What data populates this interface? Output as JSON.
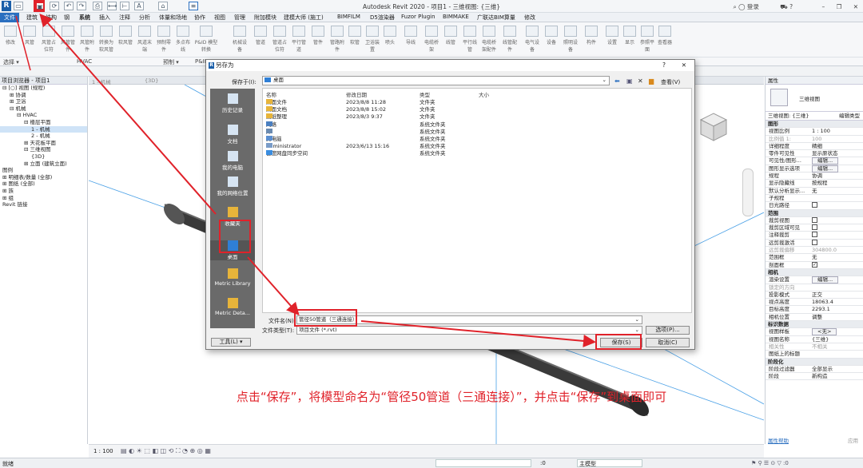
{
  "app": {
    "logo": "R",
    "title": "Autodesk Revit 2020 - 项目1 - 三维视图: {三维}",
    "login": "登录"
  },
  "menu": [
    "文件",
    "建筑",
    "结构",
    "钢",
    "系统",
    "插入",
    "注释",
    "分析",
    "体量和场地",
    "协作",
    "视图",
    "管理",
    "附加模块",
    "建模大师 (施工)",
    "BIMFILM",
    "D5渲染器",
    "Fuzor Plugin",
    "BIMMAKE",
    "广联达BIM算量",
    "修改"
  ],
  "ribbon": {
    "buttons": [
      "修改",
      "风管",
      "风管占位符",
      "风管管件",
      "风管附件",
      "转换为软风管",
      "软风管",
      "风道末端",
      "预制零件",
      "多点布线",
      "P&ID 模型转换",
      "机械设备",
      "管道",
      "管道占位符",
      "平行管道",
      "管件",
      "管路附件",
      "软管",
      "卫浴装置",
      "喷头",
      "导线",
      "电缆桥架",
      "线管",
      "平行线管",
      "电缆桥架配件",
      "线管配件",
      "电气设备",
      "设备",
      "照明设备",
      "构件",
      "设置",
      "显示",
      "参照平面",
      "查看器"
    ],
    "groups": [
      "选择 ▾",
      "HVAC",
      "预制 ▾",
      "P&ID"
    ]
  },
  "browser": {
    "title": "项目浏览器 - 项目1",
    "tree": [
      {
        "t": "⊟ [○] 视图 (规程)",
        "d": 0
      },
      {
        "t": "⊞ 协调",
        "d": 1
      },
      {
        "t": "⊞ 卫浴",
        "d": 1
      },
      {
        "t": "⊟ 机械",
        "d": 1
      },
      {
        "t": "⊟ HVAC",
        "d": 2
      },
      {
        "t": "⊟ 楼层平面",
        "d": 3
      },
      {
        "t": "1 - 机械",
        "d": 4,
        "sel": true
      },
      {
        "t": "2 - 机械",
        "d": 4
      },
      {
        "t": "⊞ 天花板平面",
        "d": 3
      },
      {
        "t": "⊟ 三维视图",
        "d": 3
      },
      {
        "t": "{3D}",
        "d": 4
      },
      {
        "t": "⊞ 立面 (建筑立面)",
        "d": 3
      },
      {
        "t": "图例",
        "d": 0
      },
      {
        "t": "⊞ 明细表/数量 (全部)",
        "d": 0
      },
      {
        "t": "⊞ 图纸 (全部)",
        "d": 0
      },
      {
        "t": "⊞ 族",
        "d": 0
      },
      {
        "t": "⊞ 组",
        "d": 0
      },
      {
        "t": "Revit 链接",
        "d": 0
      }
    ]
  },
  "view": {
    "tabs": [
      "1 - 机械",
      "{3D}"
    ],
    "scale": "1 : 100"
  },
  "properties": {
    "title": "属性",
    "type_name": "三维视图",
    "selector": "三维视图: {三维}",
    "edit_type": "编辑类型",
    "rows": [
      {
        "k": "图形",
        "sec": true
      },
      {
        "k": "视图比例",
        "v": "1 : 100"
      },
      {
        "k": "比例值 1:",
        "v": "100",
        "dim": true
      },
      {
        "k": "详细程度",
        "v": "精细"
      },
      {
        "k": "零件可见性",
        "v": "显示原状态"
      },
      {
        "k": "可见性/图形...",
        "btn": "编辑..."
      },
      {
        "k": "图形显示选项",
        "btn": "编辑..."
      },
      {
        "k": "规程",
        "v": "协调"
      },
      {
        "k": "显示隐藏线",
        "v": "按规程"
      },
      {
        "k": "默认分析显示...",
        "v": "无"
      },
      {
        "k": "子规程",
        "v": ""
      },
      {
        "k": "日光路径",
        "cb": true
      },
      {
        "k": "范围",
        "sec": true
      },
      {
        "k": "裁剪视图",
        "cb": true
      },
      {
        "k": "裁剪区域可见",
        "cb": true
      },
      {
        "k": "注释裁剪",
        "cb": true
      },
      {
        "k": "远剪裁激活",
        "cb": true
      },
      {
        "k": "远剪裁偏移",
        "v": "304800.0",
        "dim": true
      },
      {
        "k": "范围框",
        "v": "无"
      },
      {
        "k": "剖面框",
        "cb": true,
        "checked": true
      },
      {
        "k": "相机",
        "sec": true
      },
      {
        "k": "渲染设置",
        "btn": "编辑..."
      },
      {
        "k": "锁定的方向",
        "v": "",
        "dim": true
      },
      {
        "k": "投影模式",
        "v": "正交"
      },
      {
        "k": "视点高度",
        "v": "18063.4"
      },
      {
        "k": "目标高度",
        "v": "2293.1"
      },
      {
        "k": "相机位置",
        "v": "调整"
      },
      {
        "k": "标识数据",
        "sec": true
      },
      {
        "k": "视图样板",
        "btn": "<无>"
      },
      {
        "k": "视图名称",
        "v": "{三维}"
      },
      {
        "k": "相关性",
        "v": "不相关",
        "dim": true
      },
      {
        "k": "图纸上的标题",
        "v": ""
      },
      {
        "k": "阶段化",
        "sec": true
      },
      {
        "k": "阶段过滤器",
        "v": "全部显示"
      },
      {
        "k": "阶段",
        "v": "新构造"
      }
    ],
    "help": "属性帮助",
    "apply": "应用"
  },
  "dialog": {
    "logo": "R",
    "title": "另存为",
    "help": "?",
    "close": "✕",
    "lookin_label": "保存于(I):",
    "lookin_value": "桌面",
    "view_menu": "查看(V)",
    "places": [
      "历史记录",
      "文档",
      "我的电脑",
      "我的网络位置",
      "收藏夹",
      "桌面",
      "Metric Library",
      "Metric Deta..."
    ],
    "columns": [
      "名称",
      "修改日期",
      "类型",
      "大小"
    ],
    "files": [
      {
        "name": "桌面文件",
        "date": "2023/8/8 11:28",
        "type": "文件夹",
        "icon": "folder"
      },
      {
        "name": "桌面文档",
        "date": "2023/8/8 15:02",
        "type": "文件夹",
        "icon": "folder"
      },
      {
        "name": "图纸整理",
        "date": "2023/8/3 9:37",
        "type": "文件夹",
        "icon": "folder"
      },
      {
        "name": "网络",
        "date": "",
        "type": "系统文件夹",
        "icon": "network"
      },
      {
        "name": "库",
        "date": "",
        "type": "系统文件夹",
        "icon": "library"
      },
      {
        "name": "此电脑",
        "date": "",
        "type": "系统文件夹",
        "icon": "computer"
      },
      {
        "name": "Administrator",
        "date": "2023/6/13 15:16",
        "type": "系统文件夹",
        "icon": "user"
      },
      {
        "name": "百度网盘同步空间",
        "date": "",
        "type": "系统文件夹",
        "icon": "cloud"
      }
    ],
    "filename_label": "文件名(N):",
    "filename_value": "管径50管道（三通连接）",
    "filetype_label": "文件类型(T):",
    "filetype_value": "项目文件 (*.rvt)",
    "options": "选项(P)...",
    "tools": "工具(L)",
    "save": "保存(S)",
    "cancel": "取消(C)"
  },
  "status": {
    "left": "就绪",
    "right": ":0",
    "model": "主模型"
  },
  "caption": "点击“保存”，将模型命名为“管径50管道（三通连接）”，并点击“保存”到桌面即可",
  "colors": {
    "annotation": "#e0222a",
    "accent": "#2a6fc0"
  }
}
